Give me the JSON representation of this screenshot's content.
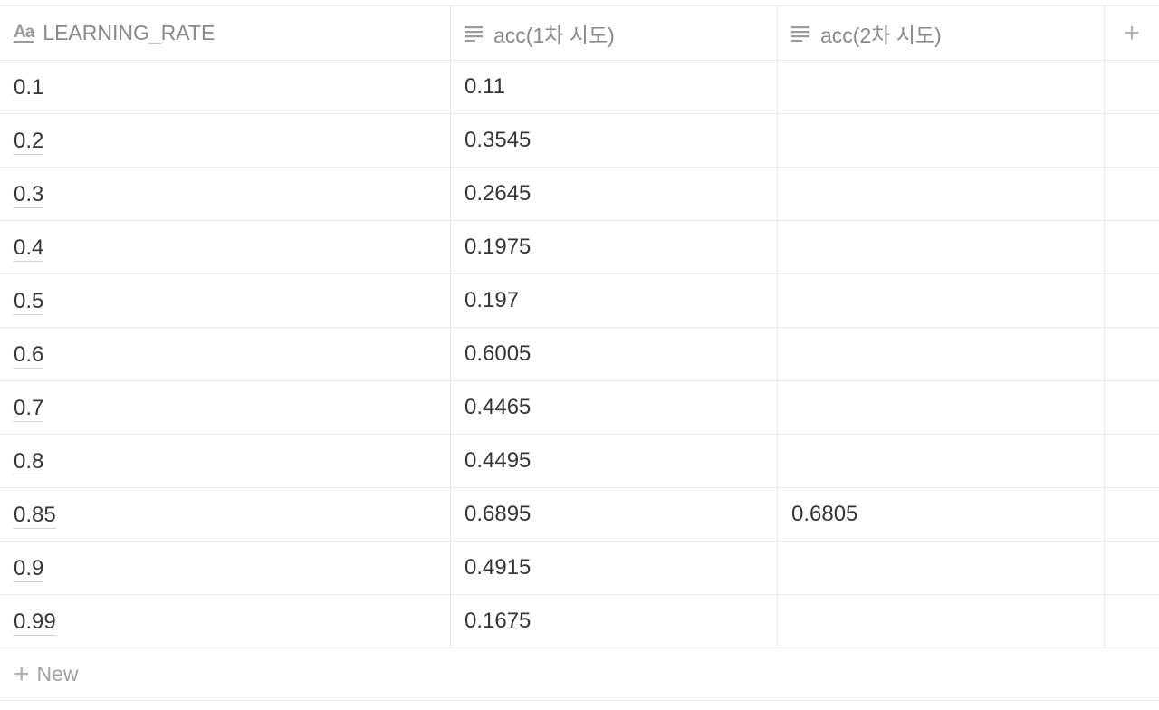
{
  "columns": [
    {
      "label": "LEARNING_RATE",
      "icon": "title-property-icon"
    },
    {
      "label": "acc(1차 시도)",
      "icon": "text-property-icon"
    },
    {
      "label": "acc(2차 시도)",
      "icon": "text-property-icon"
    }
  ],
  "add_column_label": "+",
  "rows": [
    {
      "rate": "0.1",
      "acc1": "0.11",
      "acc2": ""
    },
    {
      "rate": "0.2",
      "acc1": "0.3545",
      "acc2": ""
    },
    {
      "rate": "0.3",
      "acc1": "0.2645",
      "acc2": ""
    },
    {
      "rate": "0.4",
      "acc1": "0.1975",
      "acc2": ""
    },
    {
      "rate": "0.5",
      "acc1": "0.197",
      "acc2": ""
    },
    {
      "rate": "0.6",
      "acc1": "0.6005",
      "acc2": ""
    },
    {
      "rate": "0.7",
      "acc1": "0.4465",
      "acc2": ""
    },
    {
      "rate": "0.8",
      "acc1": "0.4495",
      "acc2": ""
    },
    {
      "rate": "0.85",
      "acc1": "0.6895",
      "acc2": "0.6805"
    },
    {
      "rate": "0.9",
      "acc1": "0.4915",
      "acc2": ""
    },
    {
      "rate": "0.99",
      "acc1": "0.1675",
      "acc2": ""
    }
  ],
  "new_row_label": "New"
}
